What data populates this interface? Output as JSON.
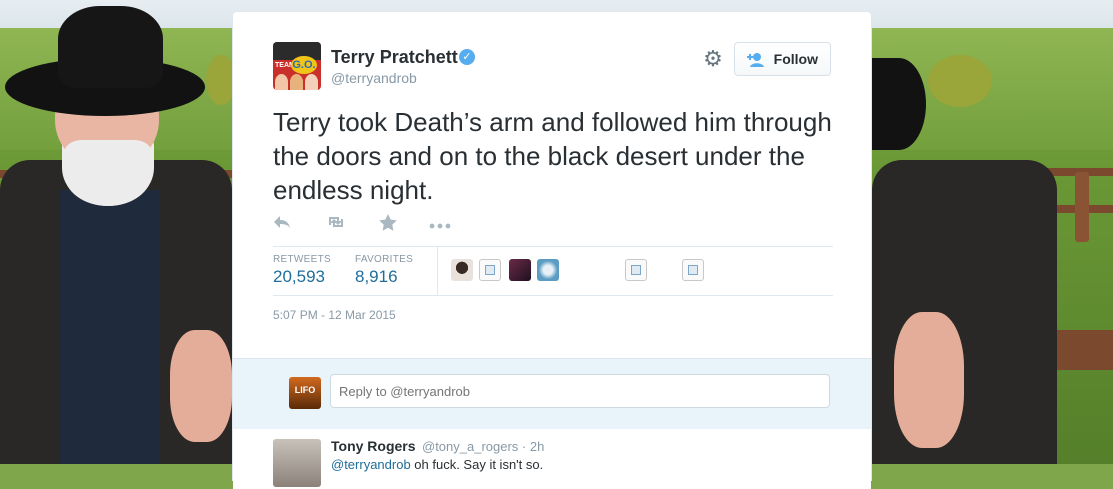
{
  "tweet": {
    "author_name": "Terry Pratchett",
    "author_handle": "@terryandrob",
    "verified_glyph": "✓",
    "avatar_text": "G.O.",
    "avatar_team": "TEAM",
    "settings_icon": "gear-icon",
    "follow_label": "Follow",
    "follow_icon": "add-user-icon",
    "text": "Terry took Death’s arm and followed him through the doors and on to the black desert under the endless night.",
    "actions": {
      "reply_icon": "reply-icon",
      "retweet_icon": "retweet-icon",
      "favorite_icon": "star-icon",
      "more_icon": "more-icon"
    },
    "stats": {
      "retweets_label": "RETWEETS",
      "retweets_value": "20,593",
      "favorites_label": "FAVORITES",
      "favorites_value": "8,916"
    },
    "timestamp": "5:07 PM - 12 Mar 2015"
  },
  "reply_box": {
    "avatar_text": "LIFO",
    "placeholder": "Reply to @terryandrob"
  },
  "reply": {
    "name": "Tony Rogers",
    "handle": "@tony_a_rogers · 2h",
    "mention": "@terryandrob",
    "text": " oh fuck. Say it isn't so."
  },
  "colors": {
    "link_blue": "#1f6d9a",
    "verified_blue": "#55acee",
    "muted_gray": "#8899a6",
    "reply_bg": "#e8f3fa"
  }
}
